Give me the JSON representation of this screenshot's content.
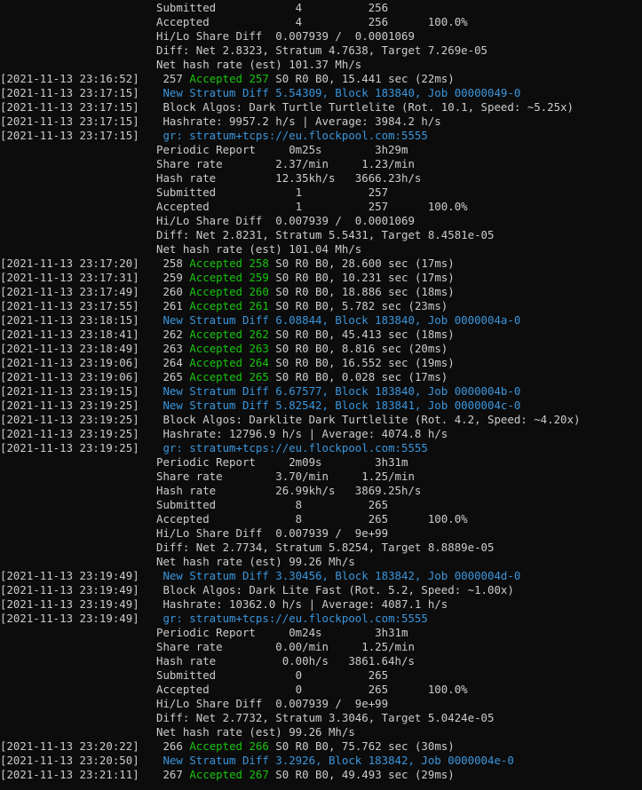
{
  "colors": {
    "background": "#0c0c0c",
    "text": "#cccccc",
    "accepted": "#16c60c",
    "stratum": "#3a96dd"
  },
  "lines": [
    {
      "ts": "",
      "segments": [
        {
          "t": "Submitted            4          256",
          "c": "white"
        }
      ]
    },
    {
      "ts": "",
      "segments": [
        {
          "t": "Accepted             4          256      100.0%",
          "c": "white"
        }
      ]
    },
    {
      "ts": "",
      "segments": [
        {
          "t": "Hi/Lo Share Diff  0.007939 /  0.0001069",
          "c": "white"
        }
      ]
    },
    {
      "ts": "",
      "segments": [
        {
          "t": "Diff: Net 2.8323, Stratum 4.7638, Target 7.269e-05",
          "c": "white"
        }
      ]
    },
    {
      "ts": "",
      "segments": [
        {
          "t": "Net hash rate (est) 101.37 Mh/s",
          "c": "white"
        }
      ]
    },
    {
      "ts": "[2021-11-13 23:16:52]",
      "segments": [
        {
          "t": " 257 ",
          "c": "white"
        },
        {
          "t": "Accepted 257",
          "c": "green"
        },
        {
          "t": " S0 R0 B0, 15.441 sec (22ms)",
          "c": "white"
        }
      ]
    },
    {
      "ts": "[2021-11-13 23:17:15]",
      "segments": [
        {
          "t": " New Stratum Diff 5.54309, Block 183840, Job 00000049-0",
          "c": "blue"
        }
      ]
    },
    {
      "ts": "[2021-11-13 23:17:15]",
      "segments": [
        {
          "t": " Block Algos: Dark Turtle Turtlelite (Rot. 10.1, Speed: ~5.25x)",
          "c": "white"
        }
      ]
    },
    {
      "ts": "[2021-11-13 23:17:15]",
      "segments": [
        {
          "t": " Hashrate: 9957.2 h/s | Average: 3984.2 h/s",
          "c": "white"
        }
      ]
    },
    {
      "ts": "[2021-11-13 23:17:15]",
      "segments": [
        {
          "t": " gr: stratum+tcps://eu.flockpool.com:5555",
          "c": "blue"
        }
      ]
    },
    {
      "ts": "",
      "segments": [
        {
          "t": "Periodic Report     0m25s        3h29m",
          "c": "white"
        }
      ]
    },
    {
      "ts": "",
      "segments": [
        {
          "t": "Share rate        2.37/min     1.23/min",
          "c": "white"
        }
      ]
    },
    {
      "ts": "",
      "segments": [
        {
          "t": "Hash rate         12.35kh/s   3666.23h/s",
          "c": "white"
        }
      ]
    },
    {
      "ts": "",
      "segments": [
        {
          "t": "Submitted            1          257",
          "c": "white"
        }
      ]
    },
    {
      "ts": "",
      "segments": [
        {
          "t": "Accepted             1          257      100.0%",
          "c": "white"
        }
      ]
    },
    {
      "ts": "",
      "segments": [
        {
          "t": "Hi/Lo Share Diff  0.007939 /  0.0001069",
          "c": "white"
        }
      ]
    },
    {
      "ts": "",
      "segments": [
        {
          "t": "Diff: Net 2.8231, Stratum 5.5431, Target 8.4581e-05",
          "c": "white"
        }
      ]
    },
    {
      "ts": "",
      "segments": [
        {
          "t": "Net hash rate (est) 101.04 Mh/s",
          "c": "white"
        }
      ]
    },
    {
      "ts": "[2021-11-13 23:17:20]",
      "segments": [
        {
          "t": " 258 ",
          "c": "white"
        },
        {
          "t": "Accepted 258",
          "c": "green"
        },
        {
          "t": " S0 R0 B0, 28.600 sec (17ms)",
          "c": "white"
        }
      ]
    },
    {
      "ts": "[2021-11-13 23:17:31]",
      "segments": [
        {
          "t": " 259 ",
          "c": "white"
        },
        {
          "t": "Accepted 259",
          "c": "green"
        },
        {
          "t": " S0 R0 B0, 10.231 sec (17ms)",
          "c": "white"
        }
      ]
    },
    {
      "ts": "[2021-11-13 23:17:49]",
      "segments": [
        {
          "t": " 260 ",
          "c": "white"
        },
        {
          "t": "Accepted 260",
          "c": "green"
        },
        {
          "t": " S0 R0 B0, 18.886 sec (18ms)",
          "c": "white"
        }
      ]
    },
    {
      "ts": "[2021-11-13 23:17:55]",
      "segments": [
        {
          "t": " 261 ",
          "c": "white"
        },
        {
          "t": "Accepted 261",
          "c": "green"
        },
        {
          "t": " S0 R0 B0, 5.782 sec (23ms)",
          "c": "white"
        }
      ]
    },
    {
      "ts": "[2021-11-13 23:18:15]",
      "segments": [
        {
          "t": " New Stratum Diff 6.08844, Block 183840, Job 0000004a-0",
          "c": "blue"
        }
      ]
    },
    {
      "ts": "[2021-11-13 23:18:41]",
      "segments": [
        {
          "t": " 262 ",
          "c": "white"
        },
        {
          "t": "Accepted 262",
          "c": "green"
        },
        {
          "t": " S0 R0 B0, 45.413 sec (18ms)",
          "c": "white"
        }
      ]
    },
    {
      "ts": "[2021-11-13 23:18:49]",
      "segments": [
        {
          "t": " 263 ",
          "c": "white"
        },
        {
          "t": "Accepted 263",
          "c": "green"
        },
        {
          "t": " S0 R0 B0, 8.816 sec (20ms)",
          "c": "white"
        }
      ]
    },
    {
      "ts": "[2021-11-13 23:19:06]",
      "segments": [
        {
          "t": " 264 ",
          "c": "white"
        },
        {
          "t": "Accepted 264",
          "c": "green"
        },
        {
          "t": " S0 R0 B0, 16.552 sec (19ms)",
          "c": "white"
        }
      ]
    },
    {
      "ts": "[2021-11-13 23:19:06]",
      "segments": [
        {
          "t": " 265 ",
          "c": "white"
        },
        {
          "t": "Accepted 265",
          "c": "green"
        },
        {
          "t": " S0 R0 B0, 0.028 sec (17ms)",
          "c": "white"
        }
      ]
    },
    {
      "ts": "[2021-11-13 23:19:15]",
      "segments": [
        {
          "t": " New Stratum Diff 6.67577, Block 183840, Job 0000004b-0",
          "c": "blue"
        }
      ]
    },
    {
      "ts": "[2021-11-13 23:19:25]",
      "segments": [
        {
          "t": " New Stratum Diff 5.82542, Block 183841, Job 0000004c-0",
          "c": "blue"
        }
      ]
    },
    {
      "ts": "[2021-11-13 23:19:25]",
      "segments": [
        {
          "t": " Block Algos: Darklite Dark Turtlelite (Rot. 4.2, Speed: ~4.20x)",
          "c": "white"
        }
      ]
    },
    {
      "ts": "[2021-11-13 23:19:25]",
      "segments": [
        {
          "t": " Hashrate: 12796.9 h/s | Average: 4074.8 h/s",
          "c": "white"
        }
      ]
    },
    {
      "ts": "[2021-11-13 23:19:25]",
      "segments": [
        {
          "t": " gr: stratum+tcps://eu.flockpool.com:5555",
          "c": "blue"
        }
      ]
    },
    {
      "ts": "",
      "segments": [
        {
          "t": "Periodic Report     2m09s        3h31m",
          "c": "white"
        }
      ]
    },
    {
      "ts": "",
      "segments": [
        {
          "t": "Share rate        3.70/min     1.25/min",
          "c": "white"
        }
      ]
    },
    {
      "ts": "",
      "segments": [
        {
          "t": "Hash rate         26.99kh/s   3869.25h/s",
          "c": "white"
        }
      ]
    },
    {
      "ts": "",
      "segments": [
        {
          "t": "Submitted            8          265",
          "c": "white"
        }
      ]
    },
    {
      "ts": "",
      "segments": [
        {
          "t": "Accepted             8          265      100.0%",
          "c": "white"
        }
      ]
    },
    {
      "ts": "",
      "segments": [
        {
          "t": "Hi/Lo Share Diff  0.007939 /  9e+99",
          "c": "white"
        }
      ]
    },
    {
      "ts": "",
      "segments": [
        {
          "t": "Diff: Net 2.7734, Stratum 5.8254, Target 8.8889e-05",
          "c": "white"
        }
      ]
    },
    {
      "ts": "",
      "segments": [
        {
          "t": "Net hash rate (est) 99.26 Mh/s",
          "c": "white"
        }
      ]
    },
    {
      "ts": "[2021-11-13 23:19:49]",
      "segments": [
        {
          "t": " New Stratum Diff 3.30456, Block 183842, Job 0000004d-0",
          "c": "blue"
        }
      ]
    },
    {
      "ts": "[2021-11-13 23:19:49]",
      "segments": [
        {
          "t": " Block Algos: Dark Lite Fast (Rot. 5.2, Speed: ~1.00x)",
          "c": "white"
        }
      ]
    },
    {
      "ts": "[2021-11-13 23:19:49]",
      "segments": [
        {
          "t": " Hashrate: 10362.0 h/s | Average: 4087.1 h/s",
          "c": "white"
        }
      ]
    },
    {
      "ts": "[2021-11-13 23:19:49]",
      "segments": [
        {
          "t": " gr: stratum+tcps://eu.flockpool.com:5555",
          "c": "blue"
        }
      ]
    },
    {
      "ts": "",
      "segments": [
        {
          "t": "Periodic Report     0m24s        3h31m",
          "c": "white"
        }
      ]
    },
    {
      "ts": "",
      "segments": [
        {
          "t": "Share rate        0.00/min     1.25/min",
          "c": "white"
        }
      ]
    },
    {
      "ts": "",
      "segments": [
        {
          "t": "Hash rate          0.00h/s   3861.64h/s",
          "c": "white"
        }
      ]
    },
    {
      "ts": "",
      "segments": [
        {
          "t": "Submitted            0          265",
          "c": "white"
        }
      ]
    },
    {
      "ts": "",
      "segments": [
        {
          "t": "Accepted             0          265      100.0%",
          "c": "white"
        }
      ]
    },
    {
      "ts": "",
      "segments": [
        {
          "t": "Hi/Lo Share Diff  0.007939 /  9e+99",
          "c": "white"
        }
      ]
    },
    {
      "ts": "",
      "segments": [
        {
          "t": "Diff: Net 2.7732, Stratum 3.3046, Target 5.0424e-05",
          "c": "white"
        }
      ]
    },
    {
      "ts": "",
      "segments": [
        {
          "t": "Net hash rate (est) 99.26 Mh/s",
          "c": "white"
        }
      ]
    },
    {
      "ts": "[2021-11-13 23:20:22]",
      "segments": [
        {
          "t": " 266 ",
          "c": "white"
        },
        {
          "t": "Accepted 266",
          "c": "green"
        },
        {
          "t": " S0 R0 B0, 75.762 sec (30ms)",
          "c": "white"
        }
      ]
    },
    {
      "ts": "[2021-11-13 23:20:50]",
      "segments": [
        {
          "t": " New Stratum Diff 3.2926, Block 183842, Job 0000004e-0",
          "c": "blue"
        }
      ]
    },
    {
      "ts": "[2021-11-13 23:21:11]",
      "segments": [
        {
          "t": " 267 ",
          "c": "white"
        },
        {
          "t": "Accepted 267",
          "c": "green"
        },
        {
          "t": " S0 R0 B0, 49.493 sec (29ms)",
          "c": "white"
        }
      ]
    }
  ]
}
